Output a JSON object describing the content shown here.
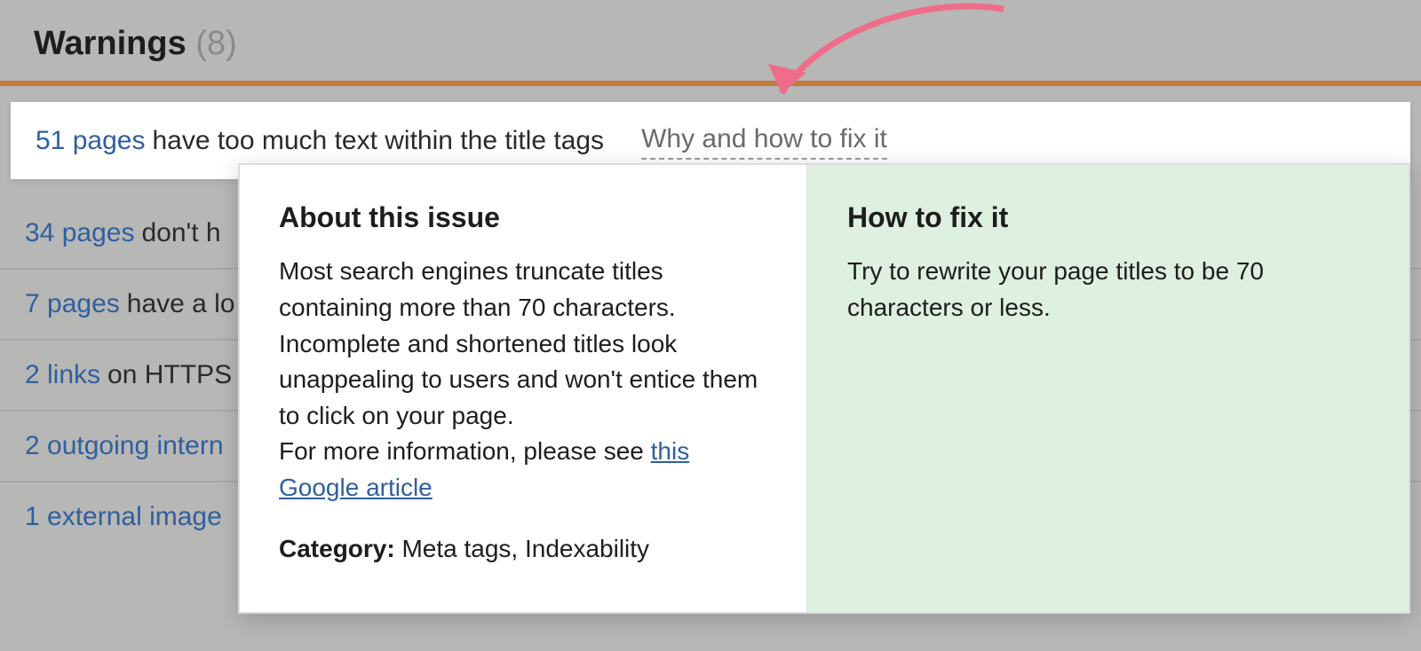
{
  "header": {
    "title": "Warnings",
    "count": "(8)"
  },
  "rows": [
    {
      "count": "51 pages",
      "desc": "have too much text within the title tags",
      "fix": "Why and how to fix it"
    },
    {
      "count": "34 pages",
      "desc": "don't h"
    },
    {
      "count": "7 pages",
      "desc": "have a lo"
    },
    {
      "count": "2 links",
      "desc": "on HTTPS"
    },
    {
      "count": "2 outgoing intern",
      "desc": ""
    },
    {
      "count": "1 external image",
      "desc": ""
    }
  ],
  "popover": {
    "about_heading": "About this issue",
    "about_body1": "Most search engines truncate titles containing more than 70 characters. Incomplete and shortened titles look unappealing to users and won't entice them to click on your page.",
    "about_body2a": "For more information, please see ",
    "about_link": "this Google article",
    "category_label": "Category: ",
    "category_value": "Meta tags, Indexability",
    "fix_heading": "How to fix it",
    "fix_body": "Try to rewrite your page titles to be 70 characters or less."
  }
}
